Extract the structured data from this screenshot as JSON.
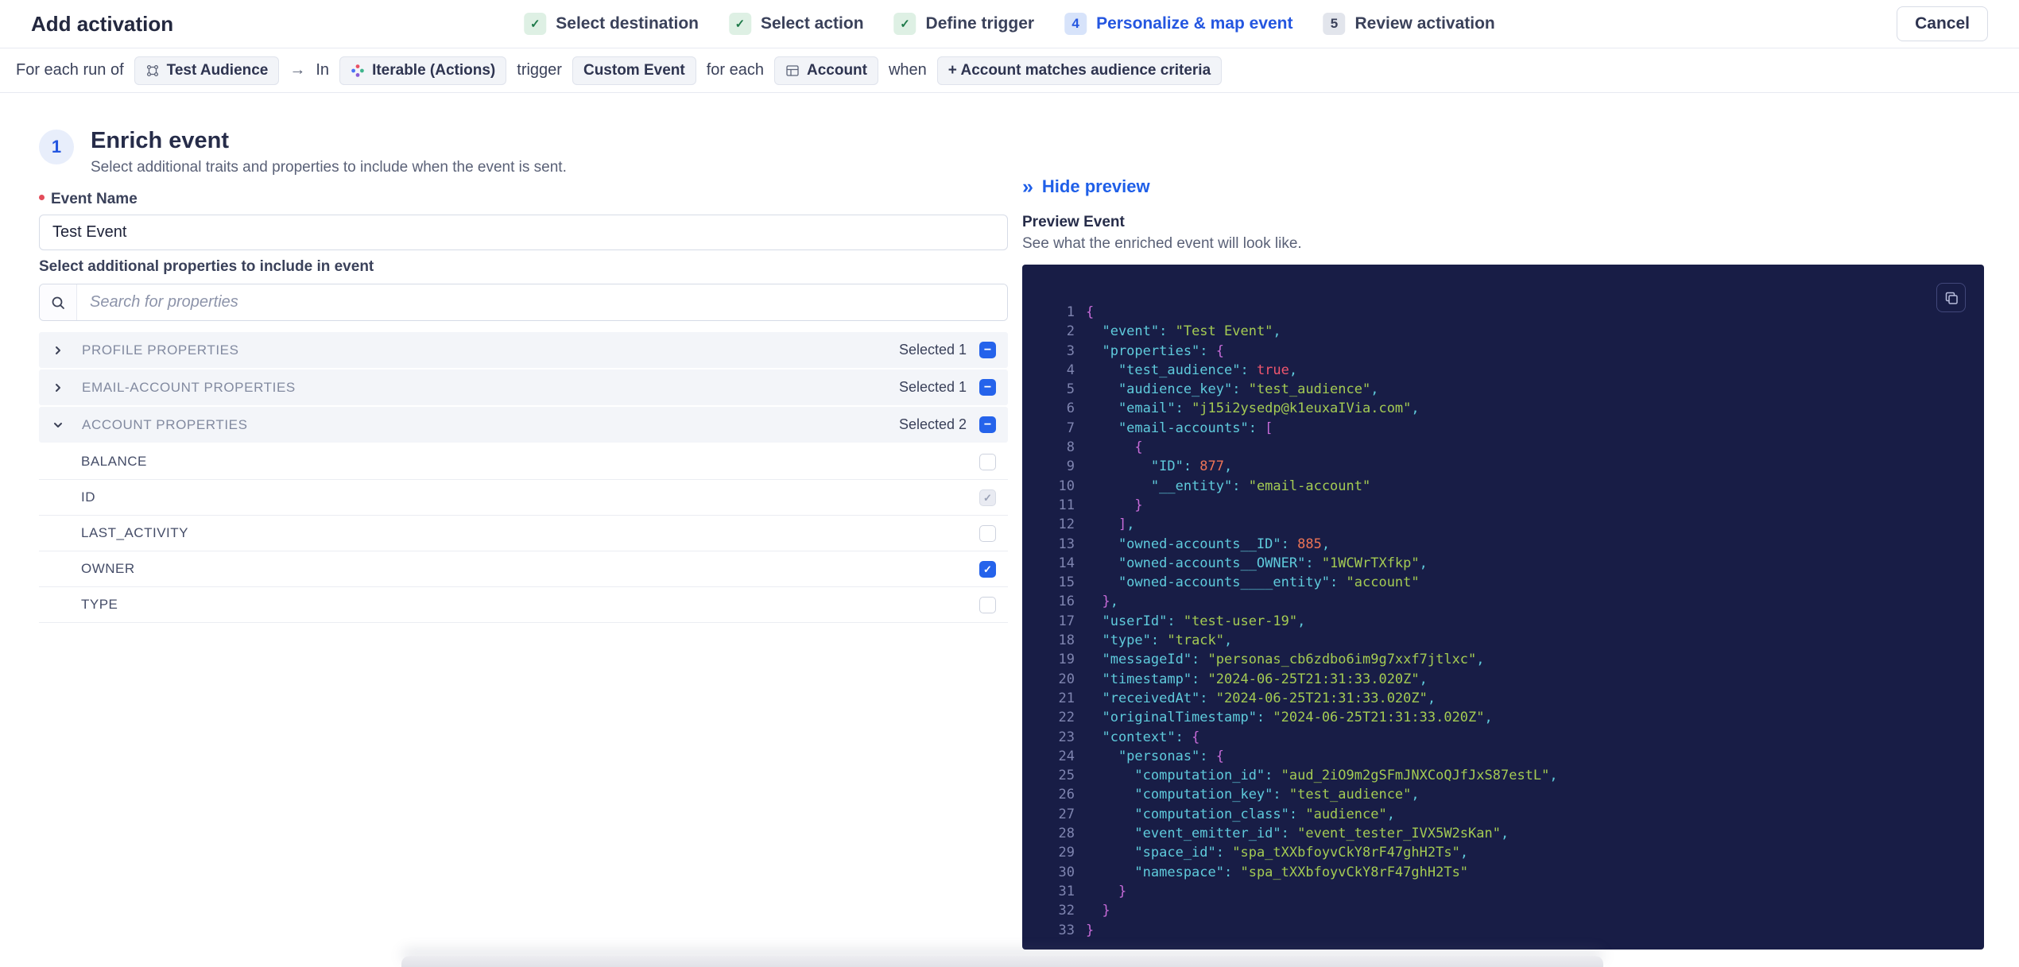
{
  "header": {
    "title": "Add activation",
    "cancel_label": "Cancel",
    "steps": [
      {
        "label": "Select destination",
        "state": "done"
      },
      {
        "label": "Select action",
        "state": "done"
      },
      {
        "label": "Define trigger",
        "state": "done"
      },
      {
        "label": "Personalize & map event",
        "state": "active",
        "number": "4"
      },
      {
        "label": "Review activation",
        "state": "upcoming",
        "number": "5"
      }
    ]
  },
  "trigger_bar": {
    "parts": [
      {
        "type": "text",
        "text": "For each run of"
      },
      {
        "type": "chip",
        "icon": "audience-icon",
        "text": "Test Audience"
      },
      {
        "type": "arrow",
        "text": "→"
      },
      {
        "type": "text",
        "text": "In"
      },
      {
        "type": "chip",
        "icon": "iterable-icon",
        "text": "Iterable (Actions)"
      },
      {
        "type": "text",
        "text": "trigger"
      },
      {
        "type": "chip",
        "text": "Custom Event"
      },
      {
        "type": "text",
        "text": "for each"
      },
      {
        "type": "chip",
        "icon": "account-icon",
        "text": "Account"
      },
      {
        "type": "text",
        "text": "when"
      },
      {
        "type": "chip",
        "text": "+ Account matches audience criteria"
      }
    ]
  },
  "enrich": {
    "step_number": "1",
    "title": "Enrich event",
    "subtitle": "Select additional traits and properties to include when the event is sent.",
    "event_name_label": "Event Name",
    "event_name_value": "Test Event",
    "properties_label": "Select additional properties to include in event",
    "search_placeholder": "Search for properties"
  },
  "property_groups": [
    {
      "label": "PROFILE PROPERTIES",
      "selected": "Selected 1",
      "expanded": false
    },
    {
      "label": "EMAIL-ACCOUNT PROPERTIES",
      "selected": "Selected 1",
      "expanded": false
    },
    {
      "label": "ACCOUNT PROPERTIES",
      "selected": "Selected 2",
      "expanded": true,
      "items": [
        {
          "label": "BALANCE",
          "checkbox": "unchecked"
        },
        {
          "label": "ID",
          "checkbox": "checked-disabled"
        },
        {
          "label": "LAST_ACTIVITY",
          "checkbox": "unchecked"
        },
        {
          "label": "OWNER",
          "checkbox": "checked"
        },
        {
          "label": "TYPE",
          "checkbox": "unchecked"
        }
      ]
    }
  ],
  "preview": {
    "hide_label": "Hide preview",
    "title": "Preview Event",
    "subtitle": "See what the enriched event will look like.",
    "code_lines": [
      [
        {
          "t": "p",
          "x": "{"
        }
      ],
      [
        {
          "t": "k",
          "x": "  \"event\": "
        },
        {
          "t": "s",
          "x": "\"Test Event\""
        },
        {
          "t": "k",
          "x": ","
        }
      ],
      [
        {
          "t": "k",
          "x": "  \"properties\": "
        },
        {
          "t": "p",
          "x": "{"
        }
      ],
      [
        {
          "t": "k",
          "x": "    \"test_audience\": "
        },
        {
          "t": "b",
          "x": "true"
        },
        {
          "t": "k",
          "x": ","
        }
      ],
      [
        {
          "t": "k",
          "x": "    \"audience_key\": "
        },
        {
          "t": "s",
          "x": "\"test_audience\""
        },
        {
          "t": "k",
          "x": ","
        }
      ],
      [
        {
          "t": "k",
          "x": "    \"email\": "
        },
        {
          "t": "s",
          "x": "\"j15i2ysedp@k1euxaIVia.com\""
        },
        {
          "t": "k",
          "x": ","
        }
      ],
      [
        {
          "t": "k",
          "x": "    \"email-accounts\": "
        },
        {
          "t": "p",
          "x": "["
        }
      ],
      [
        {
          "t": "p",
          "x": "      {"
        }
      ],
      [
        {
          "t": "k",
          "x": "        \"ID\": "
        },
        {
          "t": "n",
          "x": "877"
        },
        {
          "t": "k",
          "x": ","
        }
      ],
      [
        {
          "t": "k",
          "x": "        \"__entity\": "
        },
        {
          "t": "s",
          "x": "\"email-account\""
        }
      ],
      [
        {
          "t": "p",
          "x": "      }"
        }
      ],
      [
        {
          "t": "p",
          "x": "    ]"
        },
        {
          "t": "k",
          "x": ","
        }
      ],
      [
        {
          "t": "k",
          "x": "    \"owned-accounts__ID\": "
        },
        {
          "t": "n",
          "x": "885"
        },
        {
          "t": "k",
          "x": ","
        }
      ],
      [
        {
          "t": "k",
          "x": "    \"owned-accounts__OWNER\": "
        },
        {
          "t": "s",
          "x": "\"1WCWrTXfkp\""
        },
        {
          "t": "k",
          "x": ","
        }
      ],
      [
        {
          "t": "k",
          "x": "    \"owned-accounts____entity\": "
        },
        {
          "t": "s",
          "x": "\"account\""
        }
      ],
      [
        {
          "t": "p",
          "x": "  }"
        },
        {
          "t": "k",
          "x": ","
        }
      ],
      [
        {
          "t": "k",
          "x": "  \"userId\": "
        },
        {
          "t": "s",
          "x": "\"test-user-19\""
        },
        {
          "t": "k",
          "x": ","
        }
      ],
      [
        {
          "t": "k",
          "x": "  \"type\": "
        },
        {
          "t": "s",
          "x": "\"track\""
        },
        {
          "t": "k",
          "x": ","
        }
      ],
      [
        {
          "t": "k",
          "x": "  \"messageId\": "
        },
        {
          "t": "s",
          "x": "\"personas_cb6zdbo6im9g7xxf7jtlxc\""
        },
        {
          "t": "k",
          "x": ","
        }
      ],
      [
        {
          "t": "k",
          "x": "  \"timestamp\": "
        },
        {
          "t": "s",
          "x": "\"2024-06-25T21:31:33.020Z\""
        },
        {
          "t": "k",
          "x": ","
        }
      ],
      [
        {
          "t": "k",
          "x": "  \"receivedAt\": "
        },
        {
          "t": "s",
          "x": "\"2024-06-25T21:31:33.020Z\""
        },
        {
          "t": "k",
          "x": ","
        }
      ],
      [
        {
          "t": "k",
          "x": "  \"originalTimestamp\": "
        },
        {
          "t": "s",
          "x": "\"2024-06-25T21:31:33.020Z\""
        },
        {
          "t": "k",
          "x": ","
        }
      ],
      [
        {
          "t": "k",
          "x": "  \"context\": "
        },
        {
          "t": "p",
          "x": "{"
        }
      ],
      [
        {
          "t": "k",
          "x": "    \"personas\": "
        },
        {
          "t": "p",
          "x": "{"
        }
      ],
      [
        {
          "t": "k",
          "x": "      \"computation_id\": "
        },
        {
          "t": "s",
          "x": "\"aud_2iO9m2gSFmJNXCoQJfJxS87estL\""
        },
        {
          "t": "k",
          "x": ","
        }
      ],
      [
        {
          "t": "k",
          "x": "      \"computation_key\": "
        },
        {
          "t": "s",
          "x": "\"test_audience\""
        },
        {
          "t": "k",
          "x": ","
        }
      ],
      [
        {
          "t": "k",
          "x": "      \"computation_class\": "
        },
        {
          "t": "s",
          "x": "\"audience\""
        },
        {
          "t": "k",
          "x": ","
        }
      ],
      [
        {
          "t": "k",
          "x": "      \"event_emitter_id\": "
        },
        {
          "t": "s",
          "x": "\"event_tester_IVX5W2sKan\""
        },
        {
          "t": "k",
          "x": ","
        }
      ],
      [
        {
          "t": "k",
          "x": "      \"space_id\": "
        },
        {
          "t": "s",
          "x": "\"spa_tXXbfoyvCkY8rF47ghH2Ts\""
        },
        {
          "t": "k",
          "x": ","
        }
      ],
      [
        {
          "t": "k",
          "x": "      \"namespace\": "
        },
        {
          "t": "s",
          "x": "\"spa_tXXbfoyvCkY8rF47ghH2Ts\""
        }
      ],
      [
        {
          "t": "p",
          "x": "    }"
        }
      ],
      [
        {
          "t": "p",
          "x": "  }"
        }
      ],
      [
        {
          "t": "p",
          "x": "}"
        }
      ]
    ]
  },
  "colors": {
    "accent_blue": "#2456e0",
    "checkbox_blue": "#2563eb",
    "done_green": "#1e7a49",
    "panel_navy": "#181d46",
    "code_key": "#5fcbdc",
    "code_string": "#a4cb53",
    "code_number": "#ed7456",
    "code_boolean": "#f0566e",
    "code_brace": "#c76bd8"
  }
}
